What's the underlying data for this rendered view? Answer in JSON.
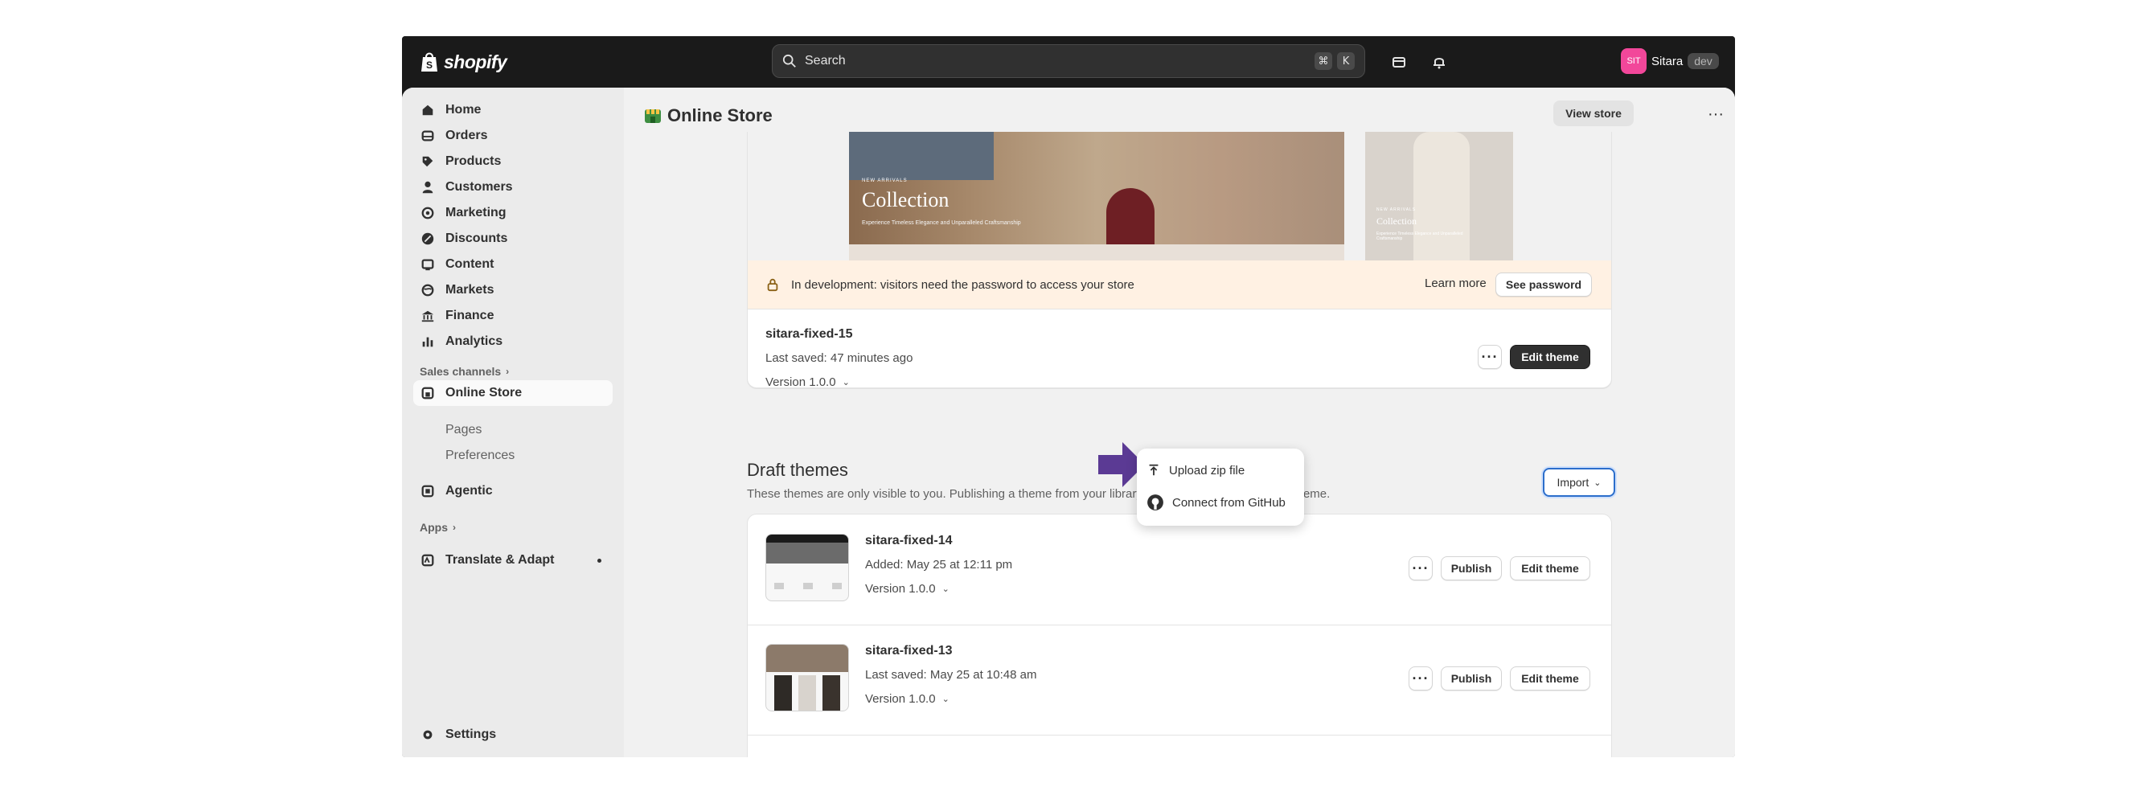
{
  "topbar": {
    "logo_text": "shopify",
    "search_placeholder": "Search",
    "shortcut_keys": [
      "⌘",
      "K"
    ],
    "user_initials": "SIT",
    "user_name": "Sitara",
    "user_badge": "dev"
  },
  "sidebar": {
    "items": [
      {
        "label": "Home",
        "icon": "home-icon"
      },
      {
        "label": "Orders",
        "icon": "orders-icon"
      },
      {
        "label": "Products",
        "icon": "tag-icon"
      },
      {
        "label": "Customers",
        "icon": "person-icon"
      },
      {
        "label": "Marketing",
        "icon": "target-icon"
      },
      {
        "label": "Discounts",
        "icon": "discount-icon"
      },
      {
        "label": "Content",
        "icon": "content-icon"
      },
      {
        "label": "Markets",
        "icon": "globe-icon"
      },
      {
        "label": "Finance",
        "icon": "bank-icon"
      },
      {
        "label": "Analytics",
        "icon": "chart-icon"
      }
    ],
    "sales_channels_label": "Sales channels",
    "online_store_label": "Online Store",
    "online_store_subitems": [
      "Pages",
      "Preferences"
    ],
    "agentic_label": "Agentic",
    "apps_label": "Apps",
    "translate_label": "Translate & Adapt",
    "settings_label": "Settings"
  },
  "header": {
    "title": "Online Store",
    "view_store_label": "View store",
    "more_label": "···"
  },
  "current_theme": {
    "preview": {
      "desktop_kicker": "NEW ARRIVALS",
      "desktop_title": "Collection",
      "desktop_subtitle": "Experience Timeless Elegance and Unparalleled Craftsmanship",
      "mobile_kicker": "NEW ARRIVALS",
      "mobile_title": "Collection",
      "mobile_subtitle": "Experience Timeless Elegance and Unparalleled Craftsmanship"
    },
    "banner_text": "In development: visitors need the password to access your store",
    "learn_more_label": "Learn more",
    "see_password_label": "See password",
    "name": "sitara-fixed-15",
    "last_saved": "Last saved: 47 minutes ago",
    "version": "Version 1.0.0",
    "more_label": "···",
    "edit_label": "Edit theme"
  },
  "drafts": {
    "title": "Draft themes",
    "description": "These themes are only visible to you. Publishing a theme from your library will switch it to your current theme.",
    "import_label": "Import",
    "items": [
      {
        "name": "sitara-fixed-14",
        "meta": "Added: May 25 at 12:11 pm",
        "version": "Version 1.0.0",
        "publish_label": "Publish",
        "edit_label": "Edit theme",
        "more_label": "···"
      },
      {
        "name": "sitara-fixed-13",
        "meta": "Last saved: May 25 at 10:48 am",
        "version": "Version 1.0.0",
        "publish_label": "Publish",
        "edit_label": "Edit theme",
        "more_label": "···"
      }
    ]
  },
  "import_menu": {
    "items": [
      {
        "label": "Upload zip file",
        "icon": "upload-icon"
      },
      {
        "label": "Connect from GitHub",
        "icon": "github-icon"
      }
    ]
  },
  "colors": {
    "topbar_bg": "#1a1a1a",
    "sidebar_bg": "#ebebeb",
    "main_bg": "#f1f1f1",
    "banner_bg": "#fff1e3",
    "focus_blue": "#2c6ecb",
    "arrow_purple": "#5b3a94",
    "avatar_pink": "#f2479a"
  }
}
